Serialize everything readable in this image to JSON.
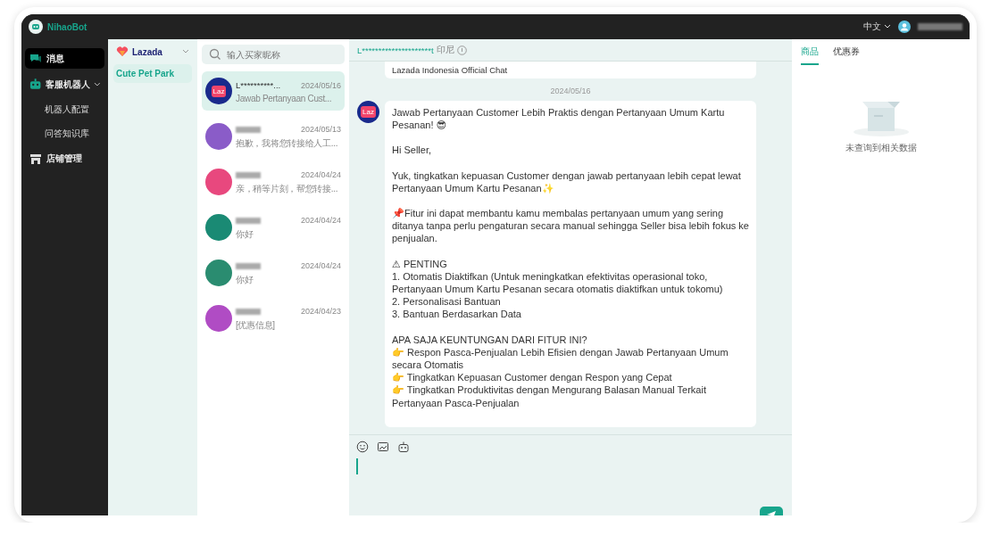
{
  "app": {
    "name": "NihaoBot",
    "language": "中文"
  },
  "nav": [
    {
      "label": "消息",
      "selected": true
    },
    {
      "label": "客服机器人",
      "expanded": true,
      "children": [
        {
          "label": "机器人配置",
          "selected": false
        },
        {
          "label": "问答知识库",
          "selected": false
        }
      ]
    },
    {
      "label": "店铺管理",
      "selected": false
    }
  ],
  "platform": {
    "name": "Lazada",
    "stores": [
      {
        "label": "Cute Pet Park",
        "selected": true
      }
    ]
  },
  "search": {
    "placeholder": "输入买家昵称"
  },
  "conversations": [
    {
      "name": "L**********...",
      "avatar_text": "Laz",
      "date": "2024/05/16",
      "preview": "Jawab Pertanyaan Cust...",
      "selected": true,
      "color": "#1a2a8c"
    },
    {
      "date": "2024/05/13",
      "preview": "抱歉，我将您转接给人工...",
      "selected": false,
      "color": "#8a5cc8"
    },
    {
      "date": "2024/04/24",
      "preview": "亲，稍等片刻，帮您转接...",
      "selected": false,
      "color": "#e8487e"
    },
    {
      "date": "2024/04/24",
      "preview": "你好",
      "selected": false,
      "color": "#1a8a74"
    },
    {
      "date": "2024/04/24",
      "preview": "你好",
      "selected": false,
      "color": "#2a8c70"
    },
    {
      "date": "2024/04/23",
      "preview": "[优惠信息]",
      "selected": false,
      "color": "#b04cc4"
    }
  ],
  "chat": {
    "buyer": "L*********************t",
    "region": "印尼",
    "previous_message": "Lazada Indonesia Official Chat",
    "date": "2024/05/16",
    "message": {
      "avatar_text": "Laz",
      "paragraphs": [
        [
          "Jawab Pertanyaan Customer Lebih Praktis dengan Pertanyaan Umum Kartu Pesanan! 😎"
        ],
        [
          "Hi Seller,"
        ],
        [
          "Yuk, tingkatkan kepuasan Customer dengan jawab pertanyaan lebih cepat lewat Pertanyaan Umum Kartu Pesanan✨"
        ],
        [
          "📌Fitur ini dapat membantu kamu membalas pertanyaan umum yang sering ditanya tanpa perlu pengaturan secara manual sehingga Seller bisa lebih fokus ke penjualan."
        ],
        [
          "⚠ PENTING",
          "1. Otomatis Diaktifkan (Untuk meningkatkan efektivitas operasional toko, Pertanyaan Umum Kartu Pesanan secara otomatis diaktifkan untuk tokomu)",
          "2. Personalisasi Bantuan",
          "3. Bantuan Berdasarkan Data"
        ],
        [
          "APA SAJA KEUNTUNGAN DARI FITUR INI?",
          "👉 Respon Pasca-Penjualan Lebih Efisien dengan Jawab Pertanyaan Umum secara Otomatis",
          "👉 Tingkatkan Kepuasan Customer dengan Respon yang Cepat",
          "👉 Tingkatkan Produktivitas dengan Mengurang Balasan Manual Terkait Pertanyaan Pasca-Penjualan"
        ]
      ]
    }
  },
  "side_panel": {
    "tabs": [
      {
        "label": "商品",
        "selected": true
      },
      {
        "label": "优惠券",
        "selected": false
      }
    ],
    "empty_text": "未查询到相关数据"
  }
}
